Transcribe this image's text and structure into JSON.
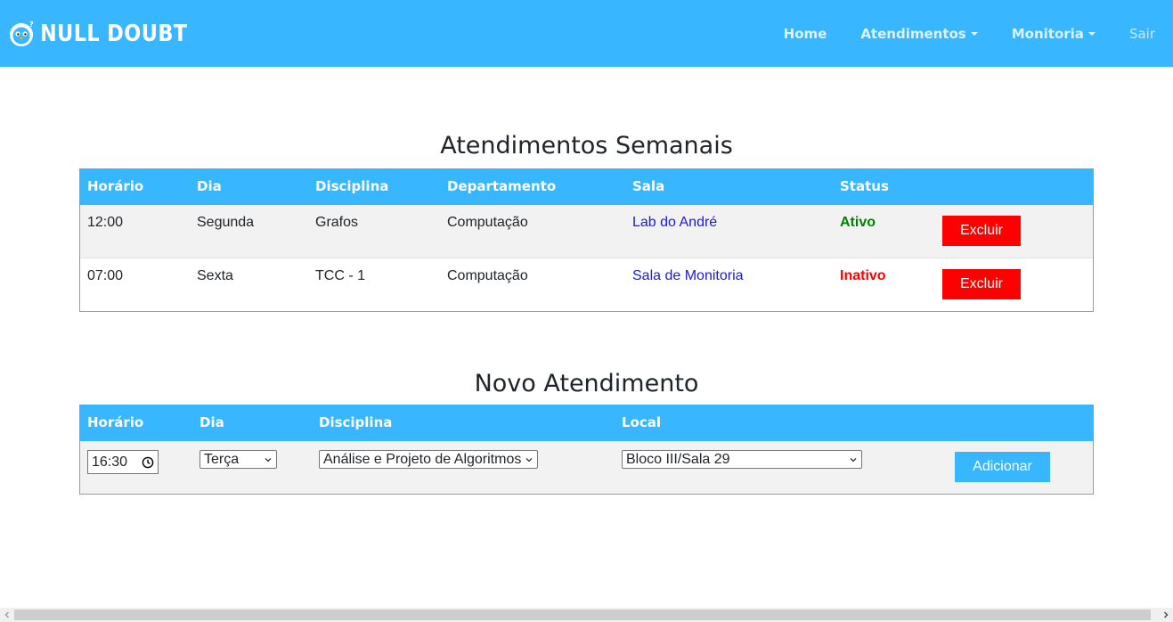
{
  "navbar": {
    "brand": "NULL DOUBT",
    "items": [
      {
        "label": "Home",
        "dropdown": false
      },
      {
        "label": "Atendimentos",
        "dropdown": true
      },
      {
        "label": "Monitoria",
        "dropdown": true
      }
    ],
    "logout": "Sair"
  },
  "colors": {
    "primary": "#38b6ff",
    "danger": "#ff0000",
    "active": "#008000",
    "link": "#1a1adf"
  },
  "weekly": {
    "title": "Atendimentos Semanais",
    "headers": [
      "Horário",
      "Dia",
      "Disciplina",
      "Departamento",
      "Sala",
      "Status"
    ],
    "rows": [
      {
        "time": "12:00",
        "day": "Segunda",
        "subject": "Grafos",
        "department": "Computação",
        "room": "Lab do André",
        "status": "Ativo",
        "action": "Excluir"
      },
      {
        "time": "07:00",
        "day": "Sexta",
        "subject": "TCC - 1",
        "department": "Computação",
        "room": "Sala de Monitoria",
        "status": "Inativo",
        "action": "Excluir"
      }
    ]
  },
  "new_session": {
    "title": "Novo Atendimento",
    "headers": [
      "Horário",
      "Dia",
      "Disciplina",
      "Local"
    ],
    "time_value": "16:30",
    "day_value": "Terça",
    "subject_value": "Análise e Projeto de Algoritmos",
    "location_value": "Bloco III/Sala 29",
    "add_label": "Adicionar"
  }
}
